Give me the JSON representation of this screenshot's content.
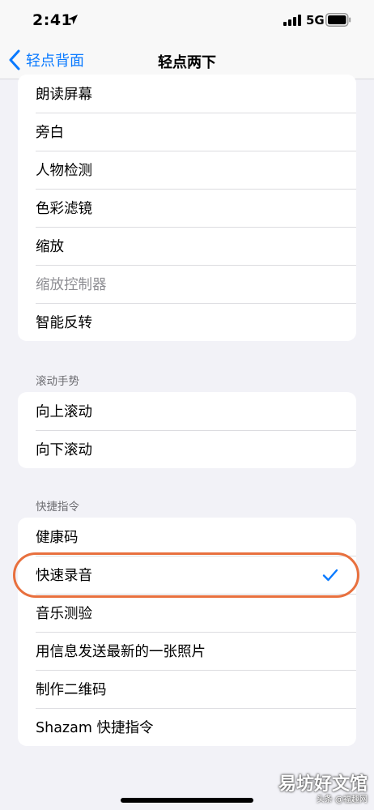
{
  "status_bar": {
    "time": "2:41",
    "network": "5G",
    "icons": [
      "location-arrow-icon",
      "cellular-signal-icon",
      "battery-icon"
    ]
  },
  "nav": {
    "back_label": "轻点背面",
    "title": "轻点两下"
  },
  "system_group": {
    "items": [
      {
        "label": "朗读屏幕",
        "disabled": false
      },
      {
        "label": "旁白",
        "disabled": false
      },
      {
        "label": "人物检测",
        "disabled": false
      },
      {
        "label": "色彩滤镜",
        "disabled": false
      },
      {
        "label": "缩放",
        "disabled": false
      },
      {
        "label": "缩放控制器",
        "disabled": true
      },
      {
        "label": "智能反转",
        "disabled": false
      }
    ]
  },
  "scroll_group": {
    "header": "滚动手势",
    "items": [
      {
        "label": "向上滚动"
      },
      {
        "label": "向下滚动"
      }
    ]
  },
  "shortcuts_group": {
    "header": "快捷指令",
    "items": [
      {
        "label": "健康码",
        "selected": false
      },
      {
        "label": "快速录音",
        "selected": true
      },
      {
        "label": "音乐测验",
        "selected": false
      },
      {
        "label": "用信息发送最新的一张照片",
        "selected": false
      },
      {
        "label": "制作二维码",
        "selected": false
      },
      {
        "label": "Shazam 快捷指令",
        "selected": false
      }
    ]
  },
  "watermark": {
    "main": "易坊好文馆",
    "sub": "头条 @福趣网"
  },
  "colors": {
    "accent": "#0a7aff",
    "highlight": "#e8703e",
    "background": "#f2f2f7",
    "disabled_text": "#8e8e93"
  }
}
